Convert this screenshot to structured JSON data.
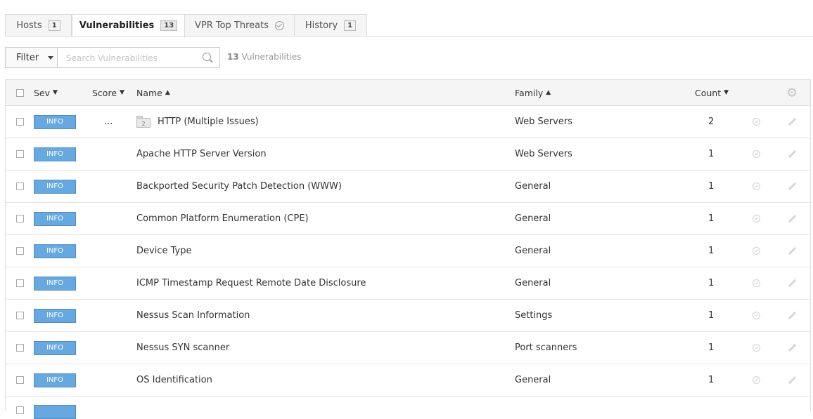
{
  "tabs": [
    {
      "label": "Hosts",
      "badge": "1"
    },
    {
      "label": "Vulnerabilities",
      "badge": "13"
    },
    {
      "label": "VPR Top Threats",
      "badge": ""
    },
    {
      "label": "History",
      "badge": "1"
    }
  ],
  "toolbar": {
    "filter_label": "Filter",
    "search_placeholder": "Search Vulnerabilities",
    "result_count": "13",
    "result_label": "Vulnerabilities"
  },
  "table": {
    "headers": {
      "sev": "Sev",
      "score": "Score",
      "name": "Name",
      "family": "Family",
      "count": "Count"
    },
    "rows": [
      {
        "sev": "INFO",
        "score": "...",
        "group_count": "2",
        "name": "HTTP (Multiple Issues)",
        "family": "Web Servers",
        "count": "2"
      },
      {
        "sev": "INFO",
        "score": "",
        "group_count": "",
        "name": "Apache HTTP Server Version",
        "family": "Web Servers",
        "count": "1"
      },
      {
        "sev": "INFO",
        "score": "",
        "group_count": "",
        "name": "Backported Security Patch Detection (WWW)",
        "family": "General",
        "count": "1"
      },
      {
        "sev": "INFO",
        "score": "",
        "group_count": "",
        "name": "Common Platform Enumeration (CPE)",
        "family": "General",
        "count": "1"
      },
      {
        "sev": "INFO",
        "score": "",
        "group_count": "",
        "name": "Device Type",
        "family": "General",
        "count": "1"
      },
      {
        "sev": "INFO",
        "score": "",
        "group_count": "",
        "name": "ICMP Timestamp Request Remote Date Disclosure",
        "family": "General",
        "count": "1"
      },
      {
        "sev": "INFO",
        "score": "",
        "group_count": "",
        "name": "Nessus Scan Information",
        "family": "Settings",
        "count": "1"
      },
      {
        "sev": "INFO",
        "score": "",
        "group_count": "",
        "name": "Nessus SYN scanner",
        "family": "Port scanners",
        "count": "1"
      },
      {
        "sev": "INFO",
        "score": "",
        "group_count": "",
        "name": "OS Identification",
        "family": "General",
        "count": "1"
      }
    ]
  },
  "colors": {
    "severity_info": "#67a8e0",
    "border": "#dedede"
  },
  "icons": {
    "search": "search-icon",
    "settings": "gear-icon",
    "accept": "check-circle-icon",
    "edit": "pencil-icon",
    "group": "folder-icon"
  }
}
